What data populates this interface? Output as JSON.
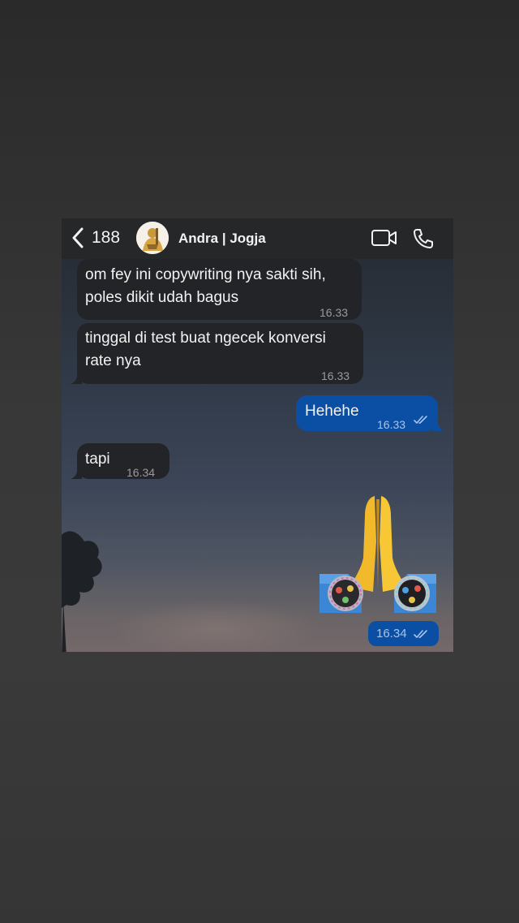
{
  "header": {
    "back_count": "188",
    "contact_name": "Andra | Jogja"
  },
  "messages": [
    {
      "direction": "incoming",
      "lines": [
        "om fey ini copywriting nya sakti sih,",
        "poles dikit udah bagus"
      ],
      "time": "16.33"
    },
    {
      "direction": "incoming",
      "lines": [
        "tinggal di test buat ngecek konversi",
        "rate nya"
      ],
      "time": "16.33"
    },
    {
      "direction": "outgoing",
      "lines": [
        "Hehehe"
      ],
      "time": "16.33",
      "read": true
    },
    {
      "direction": "incoming",
      "lines": [
        "tapi"
      ],
      "time": "16.34"
    },
    {
      "direction": "outgoing",
      "sticker": "praying-hands-with-watches",
      "time": "16.34",
      "read": true
    }
  ],
  "icons": {
    "back": "chevron-left-icon",
    "video": "video-call-icon",
    "call": "phone-icon",
    "read": "double-check-icon"
  },
  "colors": {
    "incoming_bubble": "#232427",
    "outgoing_bubble": "#0b4fa5",
    "header": "#262729",
    "text": "#f2f2f2"
  }
}
